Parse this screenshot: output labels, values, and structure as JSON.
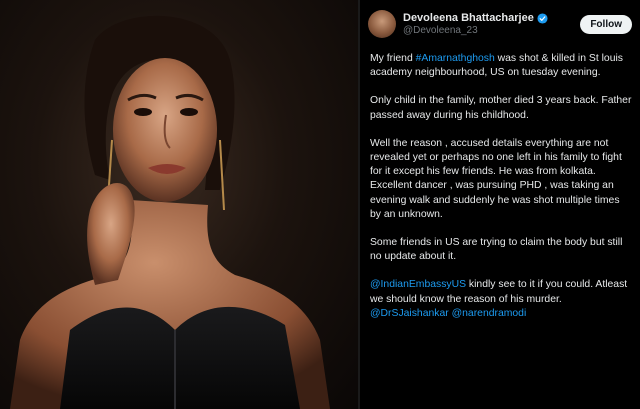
{
  "photo": {
    "alt": ""
  },
  "tweet": {
    "author": {
      "display_name": "Devoleena Bhattacharjee",
      "handle": "@Devoleena_23"
    },
    "follow_label": "Follow",
    "p1": {
      "a": "My friend ",
      "hashtag": "#Amarnathghosh",
      "b": " was shot & killed in St louis academy neighbourhood, US on tuesday evening."
    },
    "p2": "Only child in the family, mother died 3 years back. Father passed away during his childhood.",
    "p3": "Well the reason , accused details everything are not revealed yet or perhaps no one left in his family to fight for it except his few friends. He was from kolkata. Excellent dancer , was pursuing PHD , was taking an evening walk and suddenly he was shot multiple times by an unknown.",
    "p4": "Some friends in US are trying to claim the body but still no update about it.",
    "p5": {
      "mention1": "@IndianEmbassyUS",
      "text1": " kindly see to it if you could. Atleast we should know the reason of his murder. ",
      "mention2": "@DrSJaishankar",
      "space": " ",
      "mention3": "@narendramodi"
    }
  },
  "colors": {
    "link": "#1d9bf0",
    "verified": "#1d9bf0",
    "background": "#000000"
  },
  "icons": {
    "verified": "verified-badge-icon"
  }
}
